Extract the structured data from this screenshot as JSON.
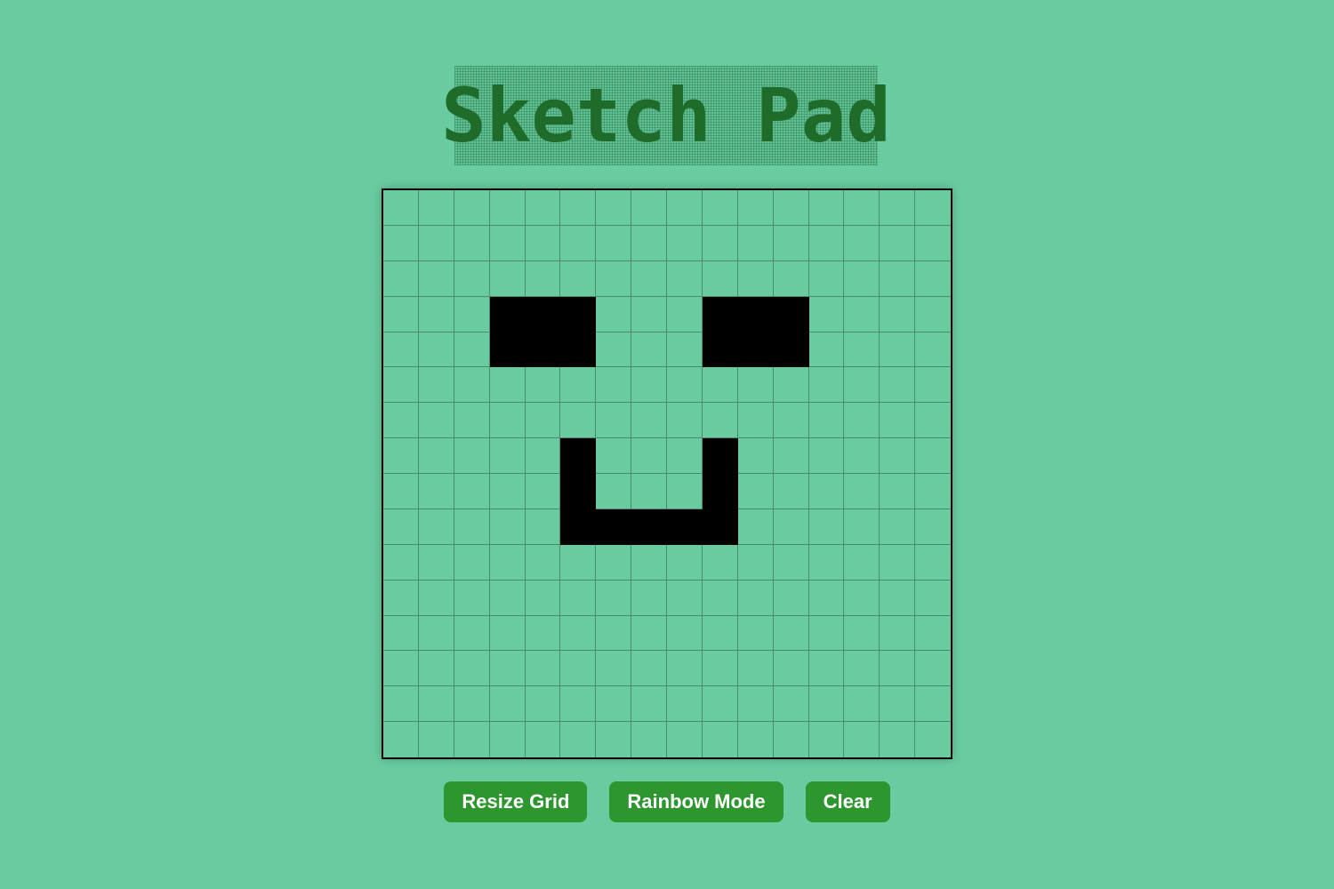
{
  "title": "Sketch Pad",
  "grid": {
    "size": 16,
    "fill_color": "#000000",
    "background_color": "#69cca1",
    "filled_cells": [
      [
        3,
        3
      ],
      [
        3,
        4
      ],
      [
        3,
        5
      ],
      [
        4,
        3
      ],
      [
        4,
        4
      ],
      [
        4,
        5
      ],
      [
        3,
        9
      ],
      [
        3,
        10
      ],
      [
        3,
        11
      ],
      [
        4,
        9
      ],
      [
        4,
        10
      ],
      [
        4,
        11
      ],
      [
        7,
        5
      ],
      [
        8,
        5
      ],
      [
        9,
        5
      ],
      [
        7,
        9
      ],
      [
        8,
        9
      ],
      [
        9,
        9
      ],
      [
        9,
        6
      ],
      [
        9,
        7
      ],
      [
        9,
        8
      ]
    ]
  },
  "controls": {
    "resize_label": "Resize Grid",
    "rainbow_label": "Rainbow Mode",
    "clear_label": "Clear"
  },
  "colors": {
    "page_background": "#69cca1",
    "title_color": "#1f6b2a",
    "button_background": "#2d962f",
    "button_text": "#ffffff"
  }
}
